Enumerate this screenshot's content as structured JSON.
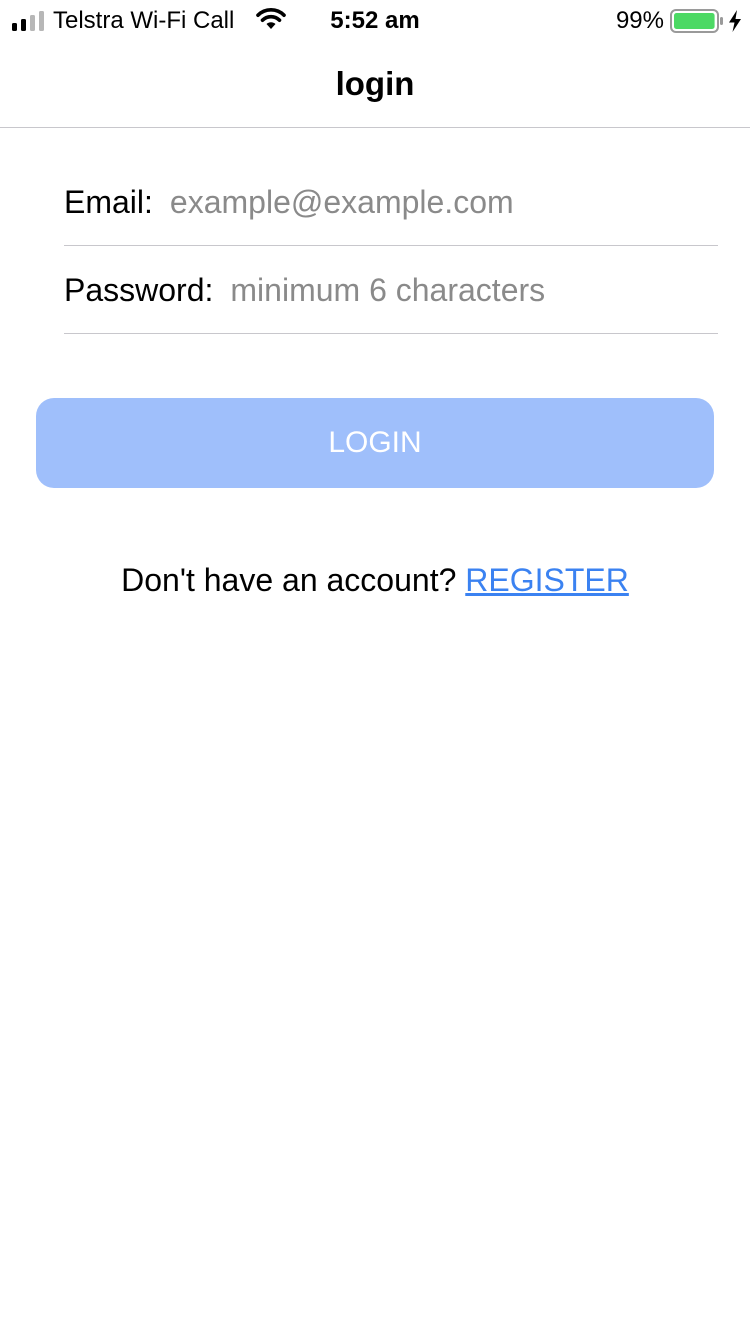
{
  "status_bar": {
    "carrier": "Telstra Wi-Fi Call",
    "time": "5:52 am",
    "battery_percent": "99%",
    "battery_level": 0.99,
    "battery_color": "#4cd964",
    "signal_icon": "cellular-signal-icon",
    "wifi_icon": "wifi-icon",
    "charging_icon": "charging-bolt-icon"
  },
  "nav": {
    "title": "login"
  },
  "form": {
    "email_label": "Email:",
    "email_placeholder": "example@example.com",
    "email_value": "",
    "password_label": "Password:",
    "password_placeholder": "minimum 6 characters",
    "password_value": ""
  },
  "login_button": {
    "label": "LOGIN",
    "color": "#9fbffb"
  },
  "register": {
    "prompt": "Don't have an account?",
    "link_label": "REGISTER",
    "link_color": "#3b82f1"
  }
}
